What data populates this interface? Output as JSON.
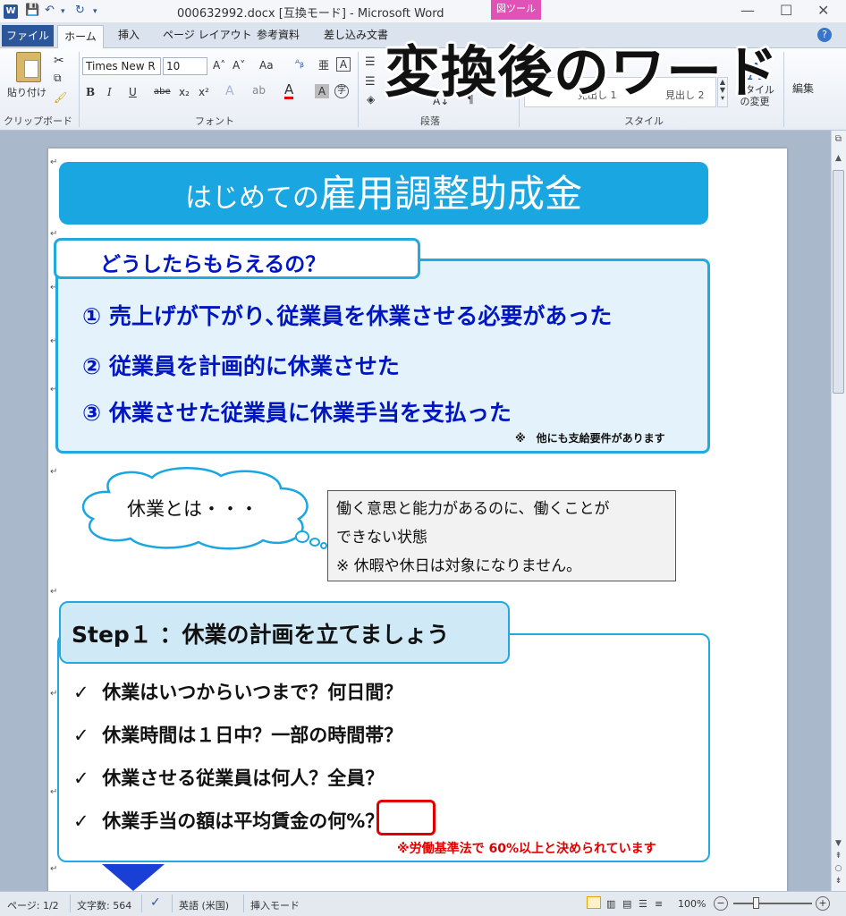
{
  "window": {
    "title": "000632992.docx [互換モード] - Microsoft Word",
    "context_tab": "図ツール",
    "controls": {
      "minimize": "—",
      "maximize": "☐",
      "close": "✕"
    }
  },
  "ribbon": {
    "tabs": [
      "ファイル",
      "ホーム",
      "挿入",
      "ページ レイアウト",
      "参考資料",
      "差し込み文書"
    ],
    "clipboard": {
      "paste_label": "貼り付け",
      "group_label": "クリップボード"
    },
    "font": {
      "font_name": "Times New R",
      "font_size": "10",
      "group_label": "フォント",
      "bold": "B",
      "italic": "I",
      "underline": "U",
      "strike": "abe",
      "subscript": "x₂",
      "superscript": "x²",
      "grow": "A˄",
      "shrink": "A˅",
      "case": "Aa"
    },
    "paragraph": {
      "group_label": "段落"
    },
    "styles": {
      "group_label": "スタイル",
      "style1": "見出し 1",
      "style2": "見出し 2",
      "change_styles": "スタイルの変更",
      "editing": "編集"
    }
  },
  "overlay_caption": "変換後のワード",
  "document": {
    "title_small": "はじめての",
    "title_big": "雇用調整助成金",
    "q_heading": "どうしたらもらえるの？",
    "q_items": [
      "① 売上げが下がり､従業員を休業させる必要があった",
      "② 従業員を計画的に休業させた",
      "③ 休業させた従業員に休業手当を支払った"
    ],
    "q_note": "※　他にも支給要件があります",
    "cloud_text": "休業とは・・・",
    "definition_lines": [
      "働く意思と能力があるのに、働くことが",
      "できない状態",
      "※ 休暇や休日は対象になりません。"
    ],
    "step_heading": "Step１ ：休業の計画を立てましょう",
    "checkmark": "✓",
    "step_items": [
      "休業はいつからいつまで？何日間？",
      "休業時間は１日中？一部の時間帯？",
      "休業させる従業員は何人？全員？"
    ],
    "step_item4_prefix": "休業手当の額は平均賃金の",
    "step_item4_highlight": "何%",
    "step_item4_suffix": "？",
    "step_note": "※労働基準法で 60%以上と決められています",
    "para_mark": "↵"
  },
  "statusbar": {
    "page": "ページ: 1/2",
    "word_count": "文字数: 564",
    "language": "英語 (米国)",
    "mode": "挿入モード",
    "zoom": "100%"
  },
  "colors": {
    "accent_blue": "#1aa6e1",
    "text_blue": "#0016c0",
    "note_red": "#e00000",
    "file_tab": "#2b579a"
  }
}
